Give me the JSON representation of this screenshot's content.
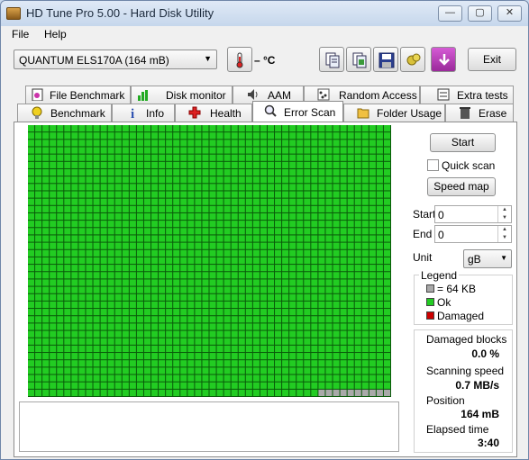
{
  "window": {
    "title": "HD Tune Pro 5.00 - Hard Disk Utility",
    "minimize_glyph": "—",
    "maximize_glyph": "▢",
    "close_glyph": "✕"
  },
  "menu": {
    "file": "File",
    "help": "Help"
  },
  "toolbar": {
    "drive": "QUANTUM ELS170A (164 mB)",
    "temperature": "– °C",
    "exit": "Exit"
  },
  "tabs": {
    "row1": [
      "File Benchmark",
      "Disk monitor",
      "AAM",
      "Random Access",
      "Extra tests"
    ],
    "row2": [
      "Benchmark",
      "Info",
      "Health",
      "Error Scan",
      "Folder Usage",
      "Erase"
    ],
    "active": "Error Scan"
  },
  "scan": {
    "grid_cols": 50,
    "grid_rows": 37,
    "total_blocks": 1850,
    "ok_blocks": 1840,
    "colors": {
      "ok": "#22cc22",
      "unscanned": "#a9a9a9",
      "damaged": "#cc0000"
    }
  },
  "controls": {
    "start": "Start",
    "quick_scan": "Quick scan",
    "speed_map": "Speed map",
    "start_label": "Start",
    "start_value": "0",
    "end_label": "End",
    "end_value": "0",
    "unit_label": "Unit",
    "unit_value": "gB"
  },
  "legend": {
    "title": "Legend",
    "block_size": "= 64 KB",
    "ok": "Ok",
    "damaged": "Damaged"
  },
  "stats": {
    "damaged_blocks_label": "Damaged blocks",
    "damaged_blocks_value": "0.0 %",
    "scanning_speed_label": "Scanning speed",
    "scanning_speed_value": "0.7 MB/s",
    "position_label": "Position",
    "position_value": "164 mB",
    "elapsed_label": "Elapsed time",
    "elapsed_value": "3:40"
  }
}
